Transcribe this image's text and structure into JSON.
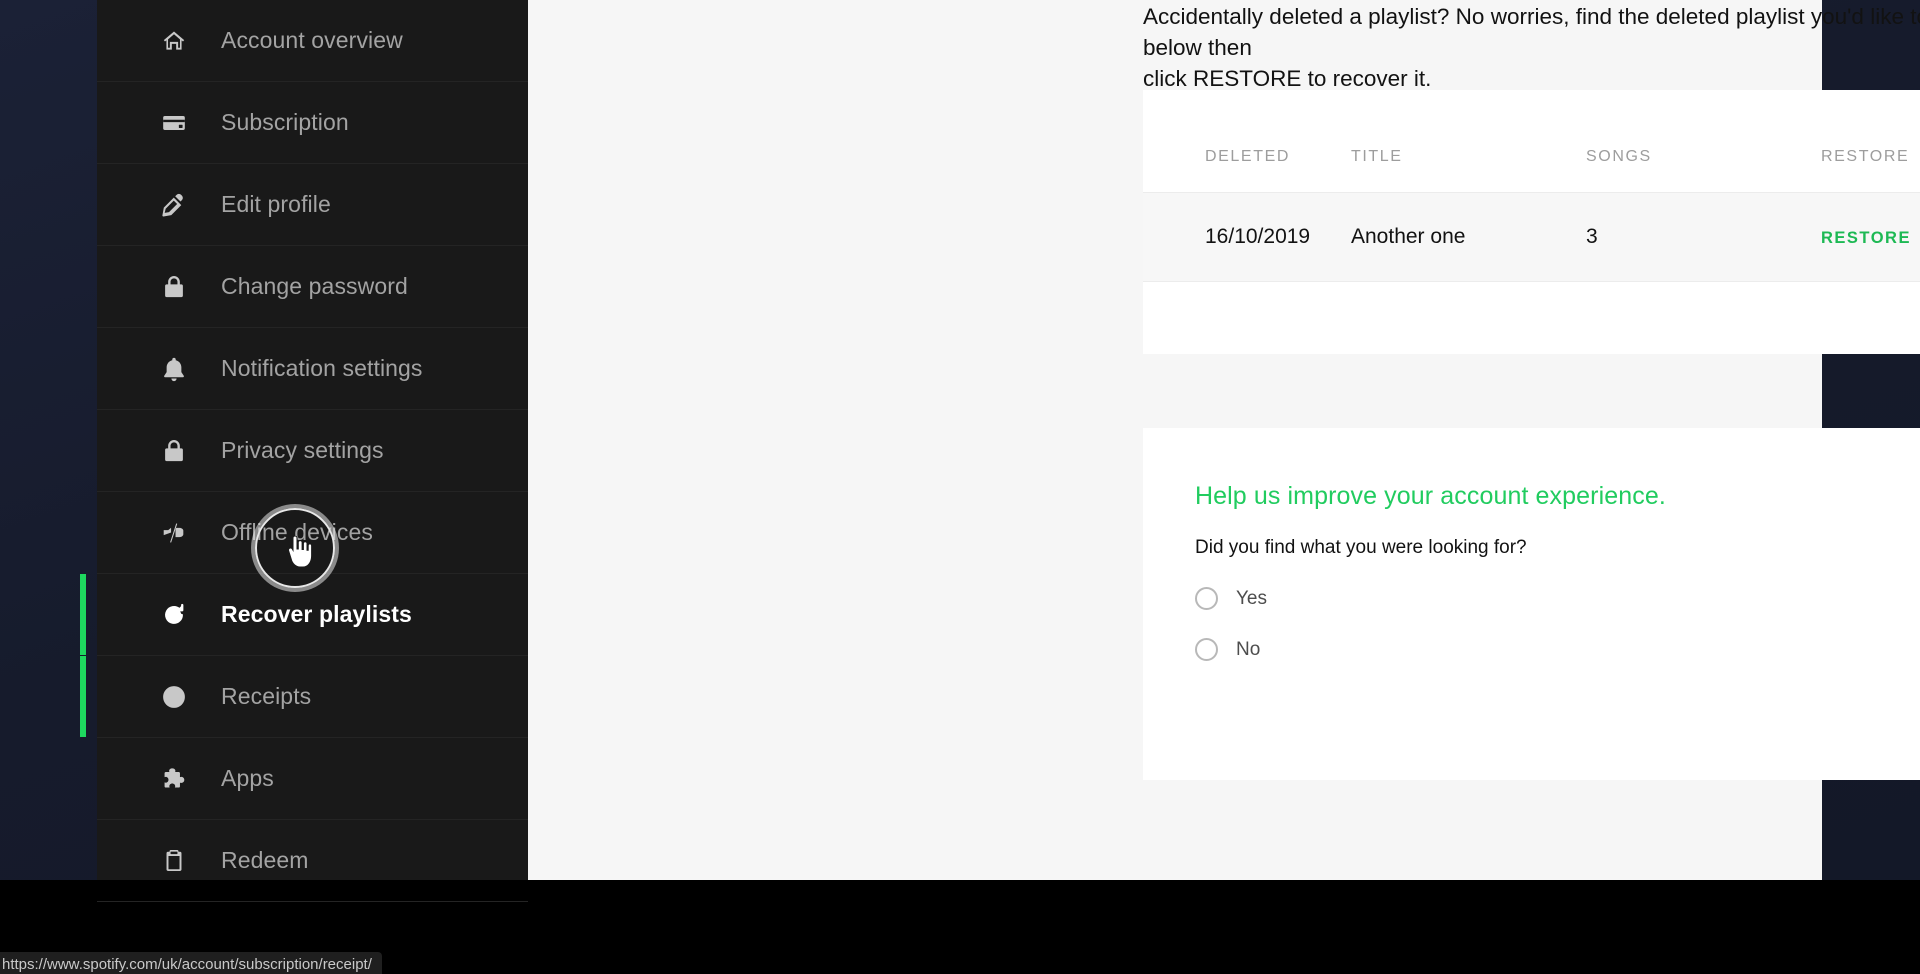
{
  "sidebar": {
    "items": [
      {
        "label": "Account overview",
        "icon": "home-icon",
        "state": "normal"
      },
      {
        "label": "Subscription",
        "icon": "credit-card-icon",
        "state": "normal"
      },
      {
        "label": "Edit profile",
        "icon": "pencil-icon",
        "state": "normal"
      },
      {
        "label": "Change password",
        "icon": "lock-icon",
        "state": "normal"
      },
      {
        "label": "Notification settings",
        "icon": "bell-icon",
        "state": "normal"
      },
      {
        "label": "Privacy settings",
        "icon": "lock-icon",
        "state": "normal"
      },
      {
        "label": "Offline devices",
        "icon": "offline-device-icon",
        "state": "normal"
      },
      {
        "label": "Recover playlists",
        "icon": "refresh-icon",
        "state": "active"
      },
      {
        "label": "Receipts",
        "icon": "clock-back-icon",
        "state": "hovered"
      },
      {
        "label": "Apps",
        "icon": "puzzle-icon",
        "state": "normal"
      },
      {
        "label": "Redeem",
        "icon": "clipboard-icon",
        "state": "normal"
      }
    ],
    "accent_color": "#1ed85f"
  },
  "main": {
    "intro_line1": "Accidentally deleted a playlist? No worries, find the deleted playlist you'd like to recover below  then",
    "intro_line2": "click RESTORE to recover it.",
    "table": {
      "headers": [
        "DELETED",
        "TITLE",
        "SONGS",
        "RESTORE"
      ],
      "rows": [
        {
          "deleted": "16/10/2019",
          "title": "Another one",
          "songs": "3",
          "restore_label": "RESTORE"
        }
      ],
      "restore_color": "#1db954"
    },
    "feedback": {
      "title": "Help us improve your account experience.",
      "title_color": "#21cc5f",
      "question": "Did you find what you were looking for?",
      "options": [
        {
          "label": "Yes",
          "selected": false
        },
        {
          "label": "No",
          "selected": false
        }
      ]
    }
  },
  "status_bar": {
    "url": "https://www.spotify.com/uk/account/subscription/receipt/"
  }
}
